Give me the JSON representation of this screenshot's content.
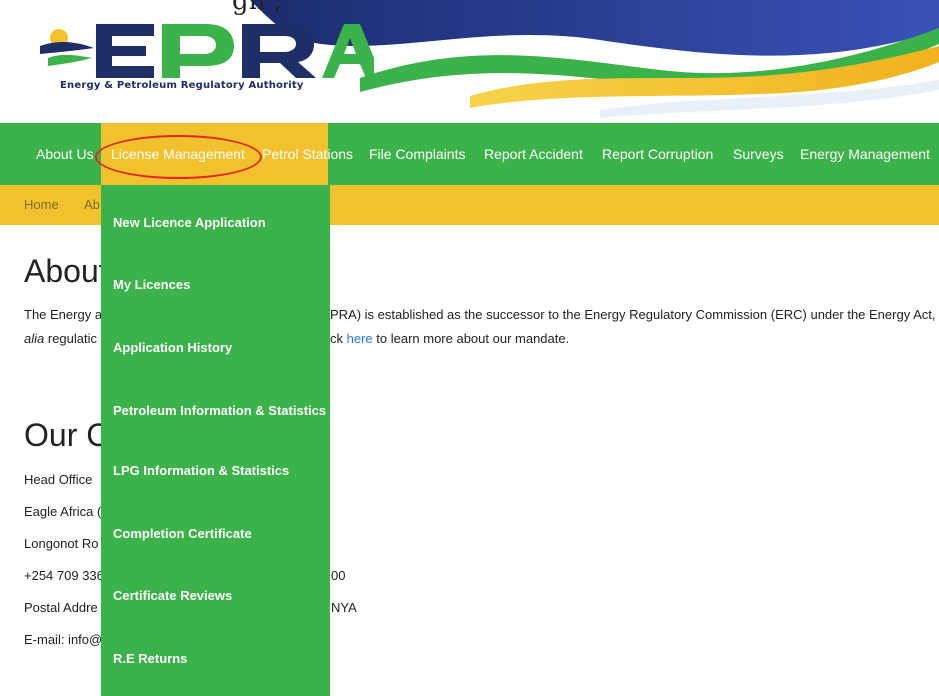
{
  "header": {
    "top_partial_text": "gn ,",
    "logo_letters": "EPRA",
    "logo_subtitle": "Energy & Petroleum Regulatory Authority"
  },
  "nav": {
    "items": [
      "About Us",
      "License Management",
      "Petrol Stations",
      "File Complaints",
      "Report Accident",
      "Report Corruption",
      "Surveys",
      "Energy Management"
    ],
    "active": "License Management"
  },
  "breadcrumb": {
    "home": "Home",
    "current_partial": "Ab"
  },
  "content": {
    "about_heading_partial": "About",
    "para_line1_left": "The Energy a",
    "para_line1_right": "PRA) is established as the successor to the Energy Regulatory Commission (ERC) under the Energy Act,",
    "para_line2_left_italic": "alia",
    "para_line2_left_rest": " regulatic",
    "para_line2_right_prefix": "ck ",
    "para_line2_link": "here",
    "para_line2_right_suffix": " to learn more about our mandate.",
    "contact_heading_partial": "Our C",
    "contact_lines": [
      {
        "left": "Head Office",
        "right": ""
      },
      {
        "left": "Eagle Africa (",
        "right": ""
      },
      {
        "left": "Longonot Ro",
        "right": ""
      },
      {
        "left": "+254 709 336",
        "right": "00"
      },
      {
        "left": "Postal Addre",
        "right": "NYA"
      },
      {
        "left": "E-mail: info@",
        "right": ""
      }
    ]
  },
  "dropdown": {
    "items": [
      "New Licence Application",
      "My Licences",
      "Application History",
      "Petroleum Information & Statistics",
      "LPG Information & Statistics",
      "Completion Certificate",
      "Certificate Reviews",
      "R.E Returns"
    ]
  },
  "colors": {
    "nav_green": "#3cb24a",
    "accent_yellow": "#f2c22e",
    "highlight_red": "#e42820",
    "logo_navy": "#1e2e66",
    "link_blue": "#2a7ae2"
  }
}
